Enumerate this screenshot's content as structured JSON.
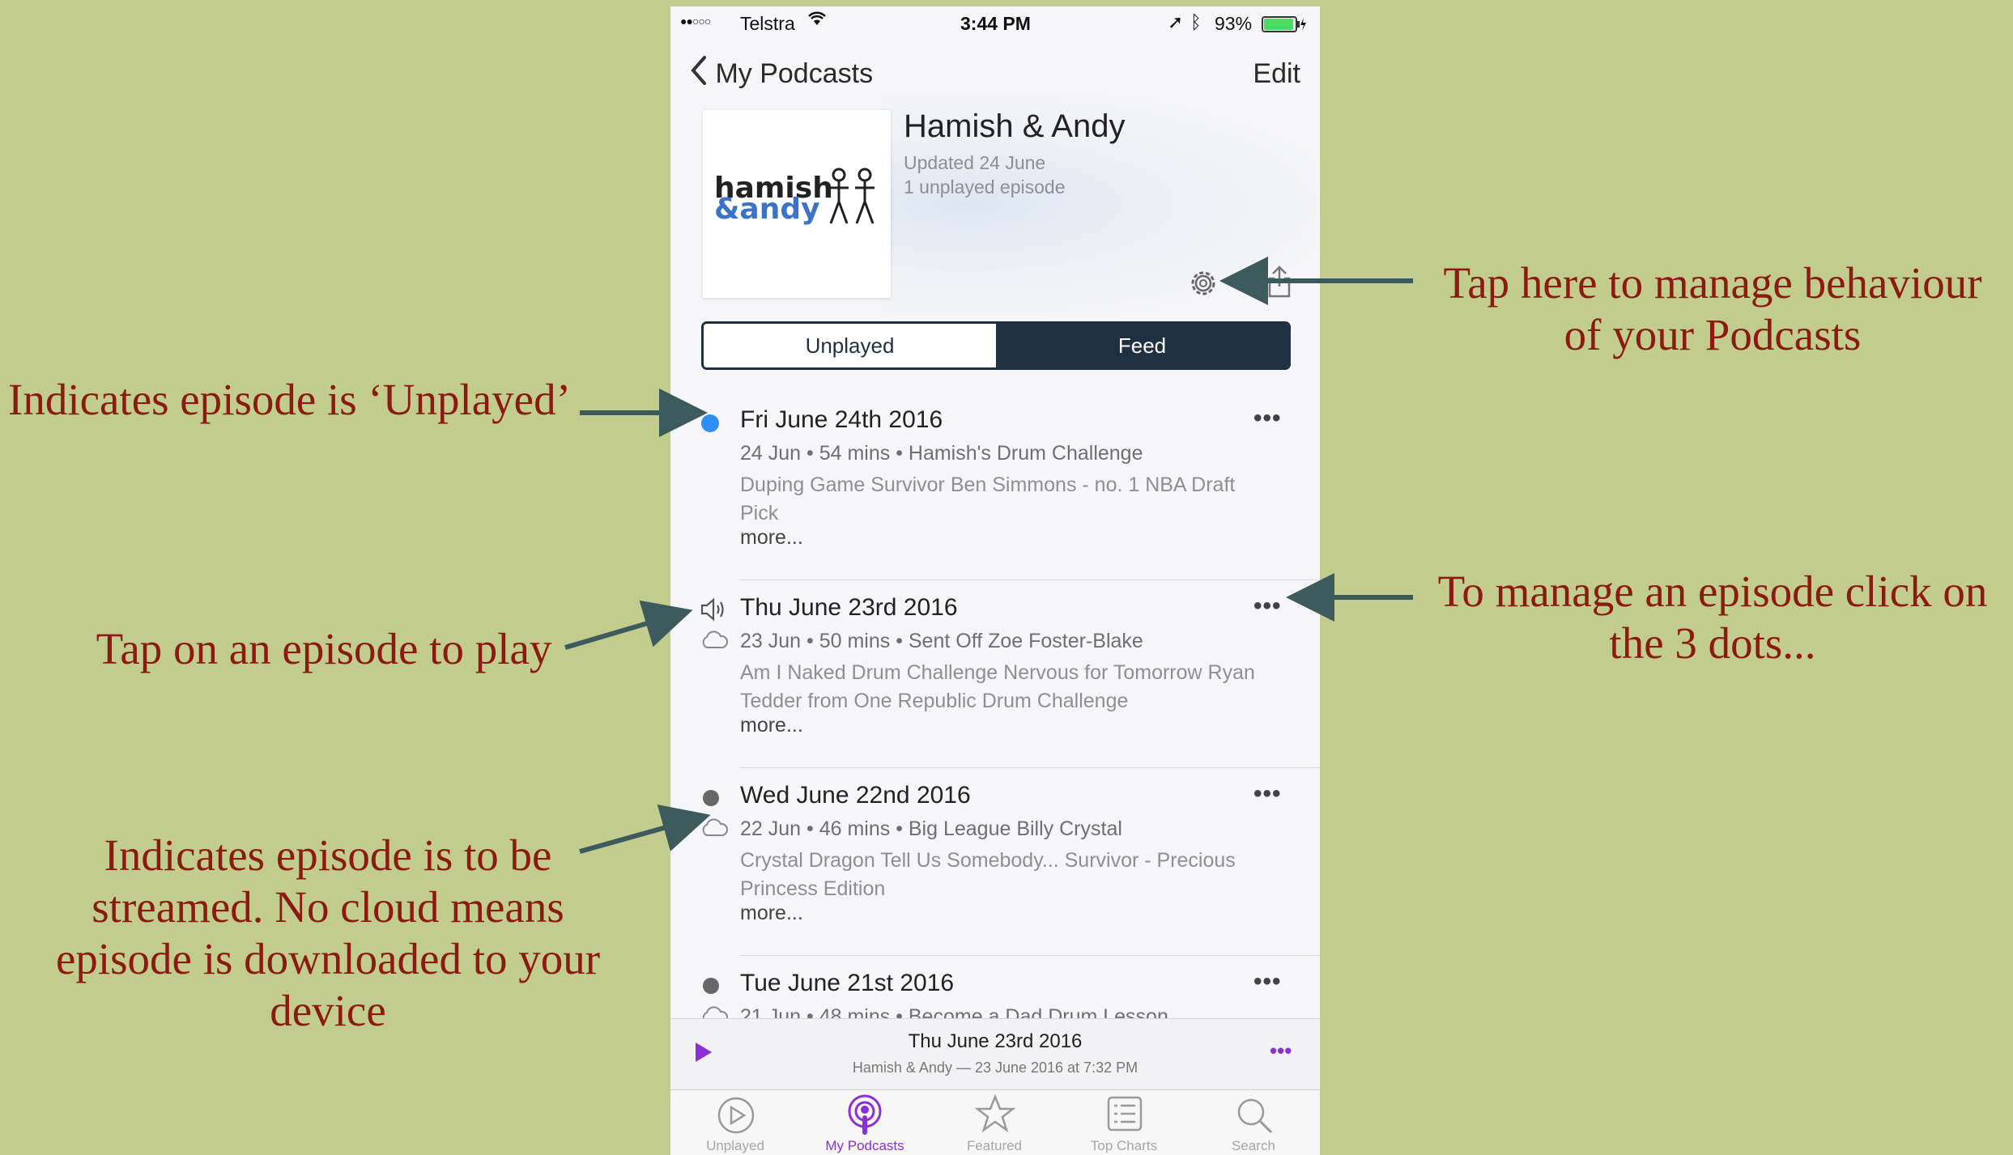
{
  "annotations": {
    "manage_behaviour": [
      "Tap here to manage behaviour",
      "of your Podcasts"
    ],
    "unplayed": "Indicates episode is ‘Unplayed’",
    "tap_play": "Tap on an episode to play",
    "manage_episode": [
      "To manage an episode click on",
      "the 3 dots..."
    ],
    "streamed": [
      "Indicates episode is to be",
      "streamed. No cloud means",
      "episode is downloaded to your",
      "device"
    ]
  },
  "status_bar": {
    "carrier": "Telstra",
    "time": "3:44 PM",
    "battery": "93%"
  },
  "nav": {
    "back_label": "My Podcasts",
    "edit_label": "Edit"
  },
  "podcast": {
    "logo_line1": "hamish",
    "logo_line2": "&andy",
    "title": "Hamish & Andy",
    "updated": "Updated 24 June",
    "unplayed_count": "1 unplayed episode"
  },
  "segments": {
    "unplayed": "Unplayed",
    "feed": "Feed"
  },
  "episodes": [
    {
      "title": "Fri June 24th 2016",
      "meta": "24 Jun • 54 mins • Hamish's Drum Challenge",
      "desc": "Duping Game Survivor Ben Simmons - no. 1 NBA Draft Pick",
      "more": "more...",
      "status": "unplayed"
    },
    {
      "title": "Thu June 23rd 2016",
      "meta": "23 Jun • 50 mins • Sent Off Zoe Foster-Blake",
      "desc": "Am I Naked Drum Challenge Nervous for Tomorrow Ryan Tedder from One Republic Drum Challenge",
      "more": "more...",
      "status": "playing"
    },
    {
      "title": "Wed June 22nd 2016",
      "meta": "22 Jun • 46 mins • Big League Billy Crystal",
      "desc": "Crystal Dragon Tell Us Somebody... Survivor - Precious Princess Edition",
      "more": "more...",
      "status": "played"
    },
    {
      "title": "Tue June 21st 2016",
      "meta": "21 Jun • 48 mins • Become a Dad Drum Lesson",
      "desc": "",
      "more": "",
      "status": "played"
    }
  ],
  "mini_player": {
    "title": "Thu June 23rd 2016",
    "subtitle": "Hamish & Andy — 23 June 2016 at 7:32 PM"
  },
  "tabs": [
    {
      "label": "Unplayed",
      "icon": "play-circle-icon",
      "active": false
    },
    {
      "label": "My Podcasts",
      "icon": "podcast-icon",
      "active": true
    },
    {
      "label": "Featured",
      "icon": "star-icon",
      "active": false
    },
    {
      "label": "Top Charts",
      "icon": "list-icon",
      "active": false
    },
    {
      "label": "Search",
      "icon": "search-icon",
      "active": false
    }
  ],
  "colors": {
    "background": "#c2cc8c",
    "annotation_text": "#8b1a12",
    "arrow": "#3d5a5c",
    "accent_blue": "#2f8ef5",
    "accent_purple": "#8b2fd6",
    "segment_dark": "#1f3042"
  }
}
